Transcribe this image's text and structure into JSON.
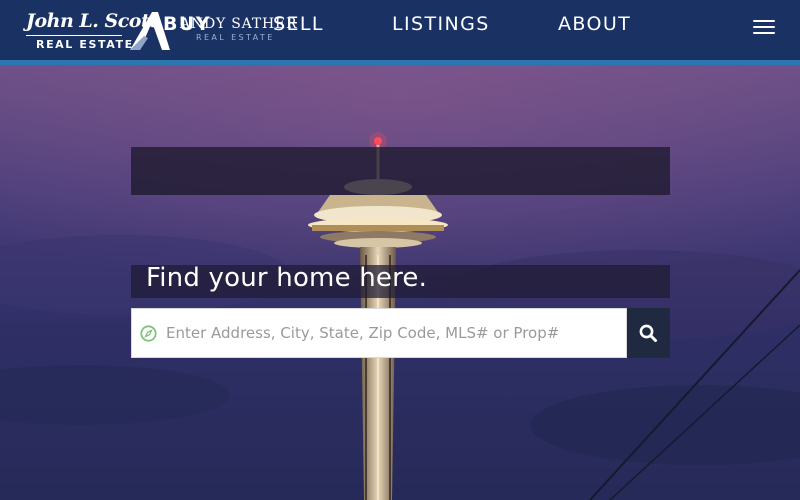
{
  "header": {
    "logo_primary": "John L. Scott",
    "logo_primary_sub": "REAL ESTATE",
    "logo_secondary": "ANDY SATHER",
    "logo_secondary_sub": "REAL ESTATE",
    "menu_icon": "hamburger-menu-icon"
  },
  "nav": {
    "tabs": [
      {
        "label": "BUY",
        "active": true
      },
      {
        "label": "SELL",
        "active": false
      },
      {
        "label": "LISTINGS",
        "active": false
      },
      {
        "label": "ABOUT",
        "active": false
      }
    ]
  },
  "hero": {
    "heading": "Find your home here."
  },
  "search": {
    "value": "",
    "placeholder": "Enter Address, City, State, Zip Code, MLS# or Prop#",
    "left_icon": "compass-icon",
    "button_icon": "search-icon"
  },
  "colors": {
    "header_bg": "#1a3163",
    "header_accent": "#2b76b0",
    "search_button_bg": "#1f2a40",
    "compass_green": "#7fc47a"
  }
}
